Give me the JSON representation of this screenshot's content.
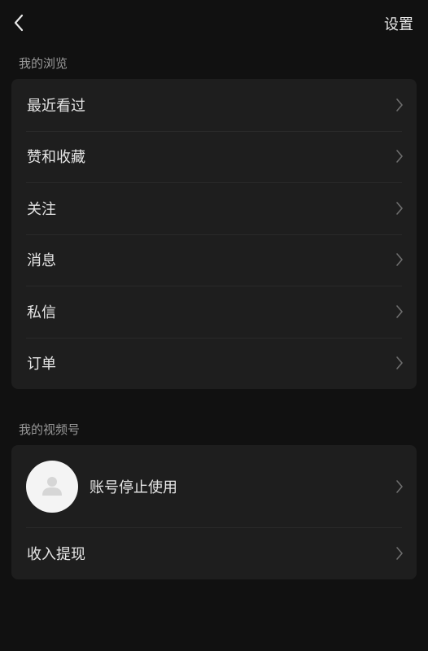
{
  "header": {
    "back_icon": "chevron-left-icon",
    "settings_label": "设置"
  },
  "browse": {
    "title": "我的浏览",
    "items": [
      {
        "label": "最近看过"
      },
      {
        "label": "赞和收藏"
      },
      {
        "label": "关注"
      },
      {
        "label": "消息"
      },
      {
        "label": "私信"
      },
      {
        "label": "订单"
      }
    ]
  },
  "channels": {
    "title": "我的视频号",
    "account_label": "账号停止使用",
    "avatar_icon": "default-avatar-icon",
    "income_label": "收入提现"
  },
  "colors": {
    "background": "#111111",
    "card": "#1e1e1e",
    "section_title": "#9a9a9a",
    "text": "#e6e6e6"
  }
}
